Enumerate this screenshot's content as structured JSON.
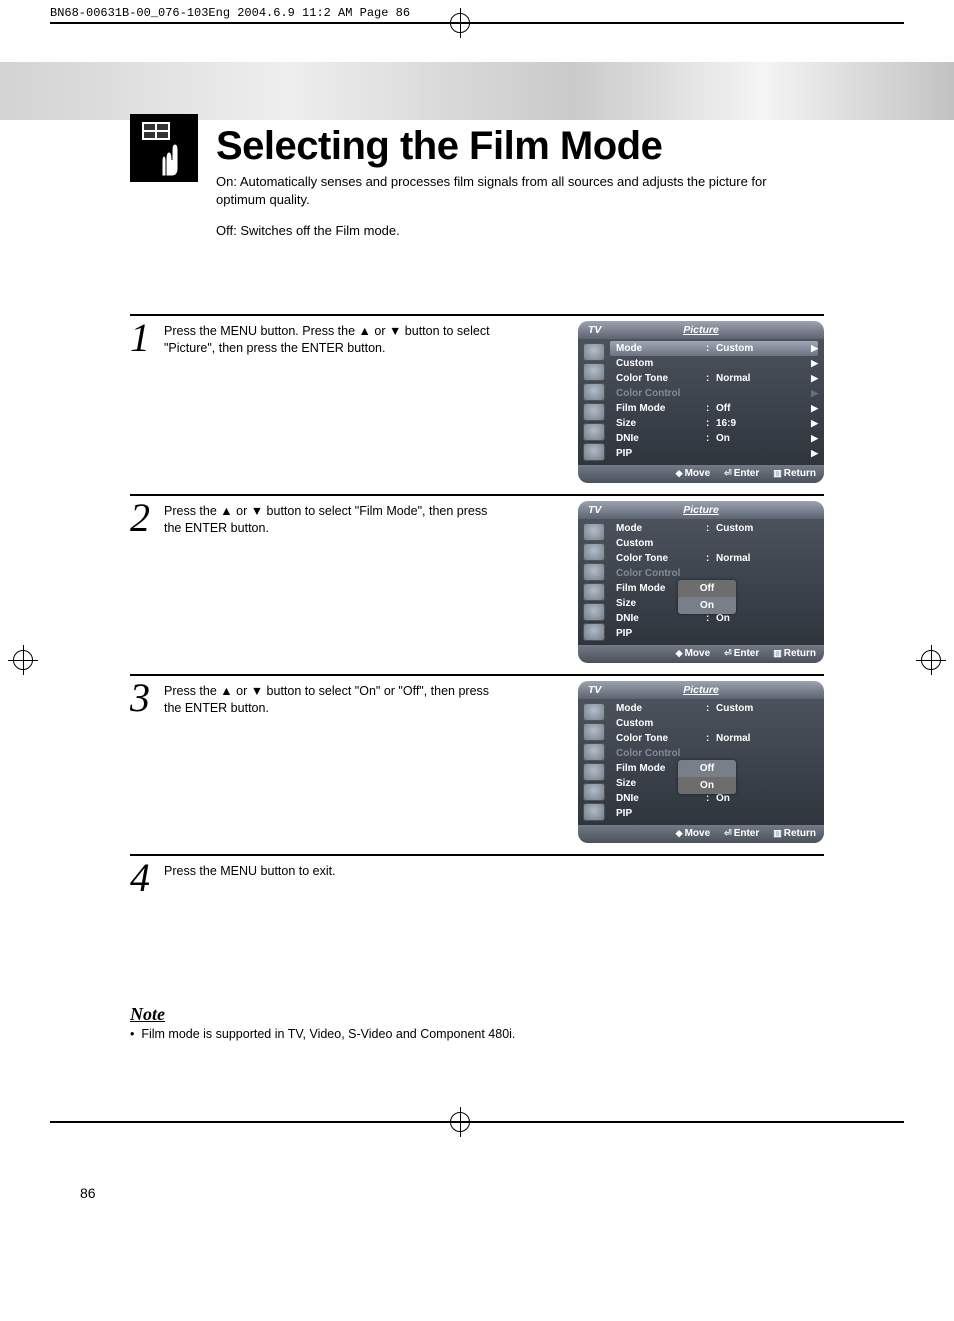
{
  "header_mark": "BN68-00631B-00_076-103Eng  2004.6.9  11:2 AM  Page 86",
  "title": "Selecting the Film Mode",
  "intro_p1": "On: Automatically senses and processes film signals from all sources and adjusts the picture for optimum quality.",
  "intro_p2": "Off: Switches off the Film mode.",
  "steps": {
    "s1": {
      "num": "1",
      "text": "Press the MENU button. Press the ▲ or ▼ button to select \"Picture\", then press the ENTER button."
    },
    "s2": {
      "num": "2",
      "text": "Press the ▲ or ▼ button to select \"Film Mode\", then press the ENTER button."
    },
    "s3": {
      "num": "3",
      "text": "Press the ▲ or ▼ button to select \"On\" or \"Off\", then press the ENTER button."
    },
    "s4": {
      "num": "4",
      "text": "Press the MENU button to exit."
    }
  },
  "osd": {
    "tv": "TV",
    "title": "Picture",
    "rows": {
      "mode": {
        "label": "Mode",
        "value": "Custom"
      },
      "custom": {
        "label": "Custom",
        "value": ""
      },
      "tone": {
        "label": "Color Tone",
        "value": "Normal"
      },
      "cc": {
        "label": "Color Control",
        "value": ""
      },
      "film": {
        "label": "Film Mode",
        "value": "Off"
      },
      "size": {
        "label": "Size",
        "value": "16:9"
      },
      "dnie": {
        "label": "DNIe",
        "value": "On"
      },
      "pip": {
        "label": "PIP",
        "value": ""
      }
    },
    "popup": {
      "off": "Off",
      "on": "On"
    },
    "bottom": {
      "move": "Move",
      "enter": "Enter",
      "return": "Return"
    }
  },
  "note_title": "Note",
  "note_body": "Film mode is supported in TV, Video, S-Video and Component 480i.",
  "page_num": "86"
}
